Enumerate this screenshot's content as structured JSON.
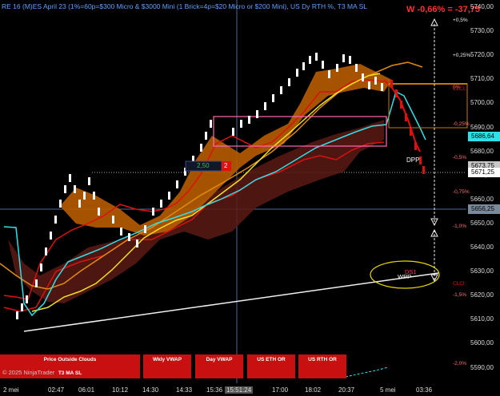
{
  "header": {
    "title": "RE 16 (M)ES April 23 (1%=60p=$300 Micro & $3000 Mini  (1 Brick=4p=$20 Micro or $200 Mini), US Dy RTH %, T3 MA SL"
  },
  "pnl": {
    "text": "W -0,66% = -37,75"
  },
  "price_axis": {
    "labels": [
      "5740,00",
      "5730,00",
      "5720,00",
      "5710,00",
      "5700,00",
      "5690,00",
      "5680,00",
      "5670,00",
      "5660,00",
      "5650,00",
      "5640,00",
      "5630,00",
      "5620,00",
      "5610,00",
      "5600,00",
      "5590,00"
    ]
  },
  "price_badges": [
    {
      "text": "5686,64",
      "bg": "#30e0e8",
      "fg": "#000000"
    },
    {
      "text": "5673,75",
      "bg": "#c8c8c8",
      "fg": "#000000"
    },
    {
      "text": "5671,25",
      "bg": "#ffffff",
      "fg": "#000000"
    },
    {
      "text": "5656,25",
      "bg": "#7a8a9a",
      "fg": "#000000"
    }
  ],
  "pct_levels": [
    "+0,5%",
    "+0,25%",
    "0%",
    "-0,25%",
    "-0,5%",
    "-0,75%",
    "-1,0%",
    "-1,5%",
    "-2,0%"
  ],
  "time_axis": {
    "labels": [
      "2 mei",
      "02:47",
      "06:01",
      "10:12",
      "14:30",
      "14:33",
      "15:36",
      "15:51:24",
      "17:00",
      "18:02",
      "20:37",
      "5 mei",
      "03:36"
    ]
  },
  "chart_labels": {
    "dpp": "DPP",
    "wpp": "WPP",
    "ds1": "DS1",
    "clcl": "CLCL",
    "clcl2": "CLCl",
    "box_left": "2,50",
    "box_right": "2"
  },
  "buttons": [
    {
      "label": "Price Outside Clouds",
      "sub": "T3 MA SL"
    },
    {
      "label": "Wkly VWAP"
    },
    {
      "label": "Day VWAP"
    },
    {
      "label": "US ETH OR"
    },
    {
      "label": "US RTH OR"
    }
  ],
  "copyright": "© 2025 NinjaTrader",
  "colors": {
    "cloud_orange": "#b85c00",
    "cloud_maroon": "#5a1a14",
    "cyan_ma": "#30e0e8",
    "yellow_ma": "#f0e020",
    "orange_ma": "#e08a10",
    "red_line": "#e01010",
    "header_blue": "#5aa0ff"
  }
}
